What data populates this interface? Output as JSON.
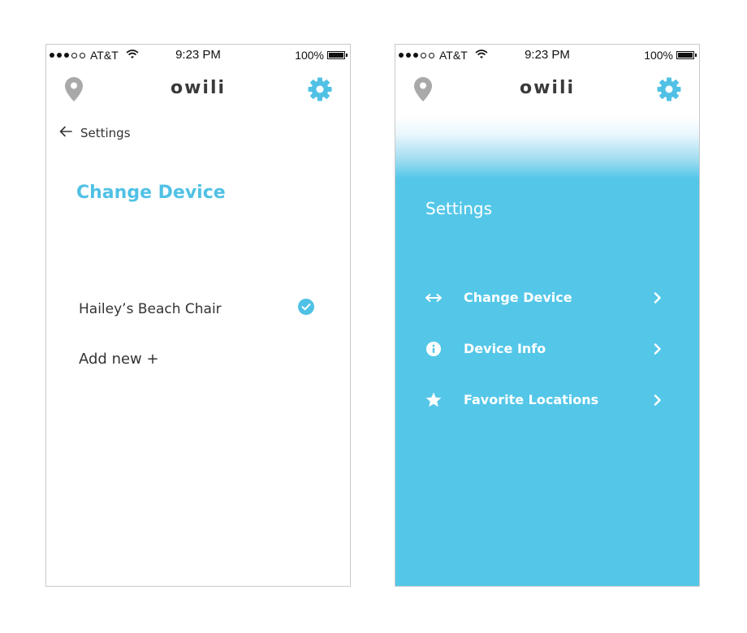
{
  "status_bar": {
    "carrier": "AT&T",
    "time": "9:23 PM",
    "battery": "100%"
  },
  "app": {
    "brand": "owili",
    "accent_color": "#50c1e5",
    "panel_color": "#54c7e8",
    "icons": [
      "location-pin-icon",
      "gear-icon",
      "back-arrow-icon",
      "check-circle-icon",
      "swap-arrows-icon",
      "info-icon",
      "star-icon",
      "chevron-right-icon"
    ]
  },
  "change_device_screen": {
    "back_label": "Settings",
    "title": "Change Device",
    "devices": [
      {
        "name": "Hailey’s Beach Chair",
        "selected": true
      }
    ],
    "add_new_label": "Add new +"
  },
  "settings_screen": {
    "title": "Settings",
    "menu": [
      {
        "label": "Change Device",
        "icon": "swap-arrows-icon"
      },
      {
        "label": "Device Info",
        "icon": "info-icon"
      },
      {
        "label": "Favorite Locations",
        "icon": "star-icon"
      }
    ]
  }
}
